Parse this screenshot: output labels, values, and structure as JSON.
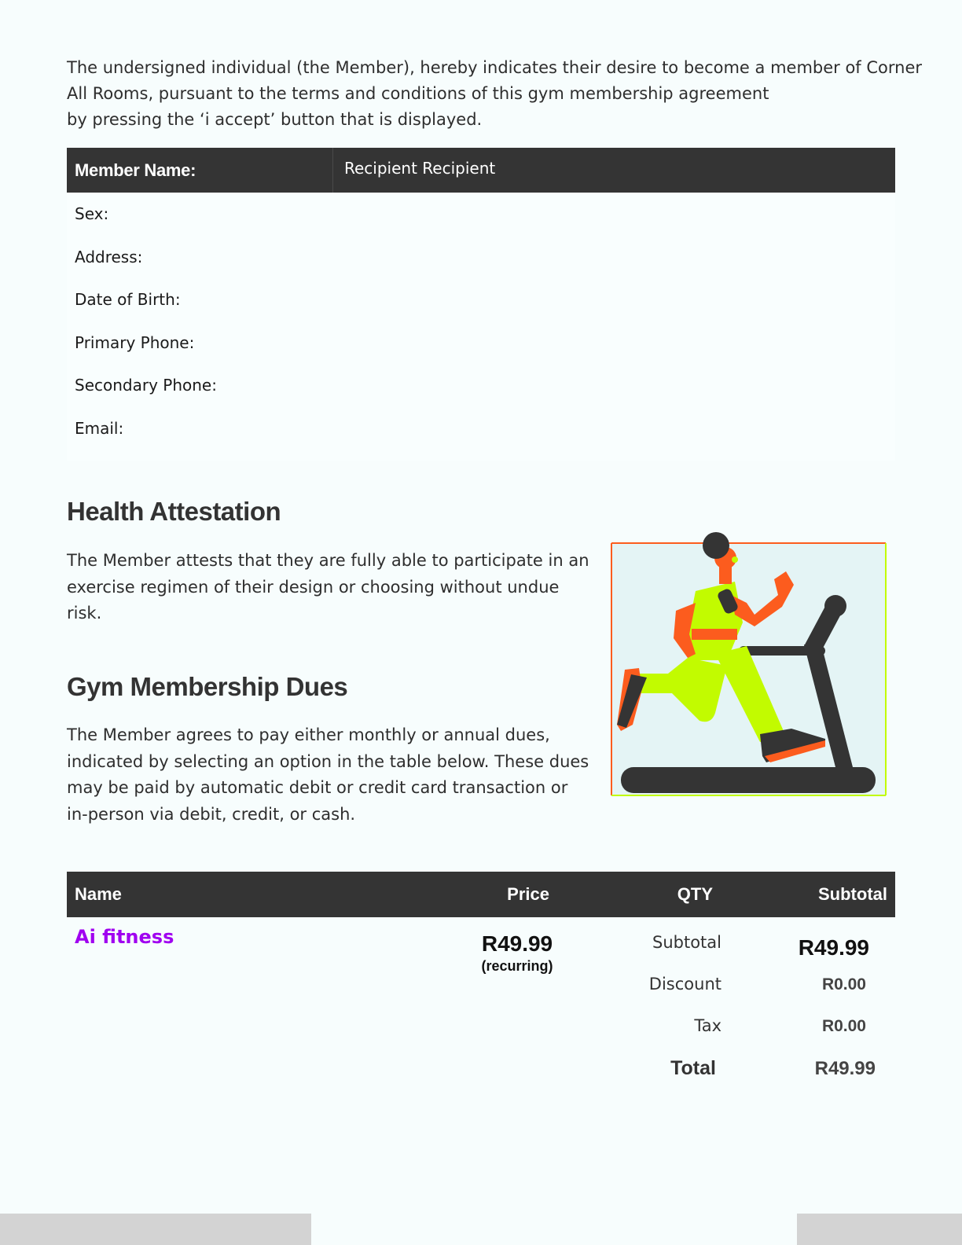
{
  "intro": {
    "line1": "The undersigned individual (the Member), hereby indicates their desire to become a member of Corner",
    "line2": "All Rooms, pursuant to the terms and conditions of this gym membership agreement",
    "line3": "by pressing the ‘i accept’ button that is displayed."
  },
  "member_table": {
    "header_label": "Member Name:",
    "header_value": "Recipient Recipient",
    "rows": [
      "Sex:",
      "Address:",
      "Date of Birth:",
      "Primary Phone:",
      "Secondary Phone:",
      "Email:"
    ]
  },
  "health": {
    "heading": "Health Attestation",
    "lines": [
      "The Member attests that they are fully able to participate in an",
      "exercise regimen of their design or choosing without undue",
      "risk."
    ]
  },
  "dues": {
    "heading": "Gym Membership Dues",
    "lines": [
      "The Member agrees to pay either monthly or annual dues,",
      "indicated by selecting an option in the table below. These dues",
      "may be paid by automatic debit or credit card transaction or",
      "in-person via debit, credit, or cash."
    ]
  },
  "pricing": {
    "headers": {
      "name": "Name",
      "price": "Price",
      "qty": "QTY",
      "subtotal": "Subtotal"
    },
    "item": {
      "name": "Ai fitness",
      "price": "R49.99",
      "price_note": "(recurring)"
    },
    "summary": {
      "subtotal_label": "Subtotal",
      "subtotal_value": "R49.99",
      "discount_label": "Discount",
      "discount_value": "R0.00",
      "tax_label": "Tax",
      "tax_value": "R0.00",
      "total_label": "Total",
      "total_value": "R49.99"
    }
  },
  "colors": {
    "header_bg": "#343434",
    "item_name": "#a000f0",
    "accent_orange": "#fc5c1e",
    "accent_lime": "#c2fb00"
  }
}
